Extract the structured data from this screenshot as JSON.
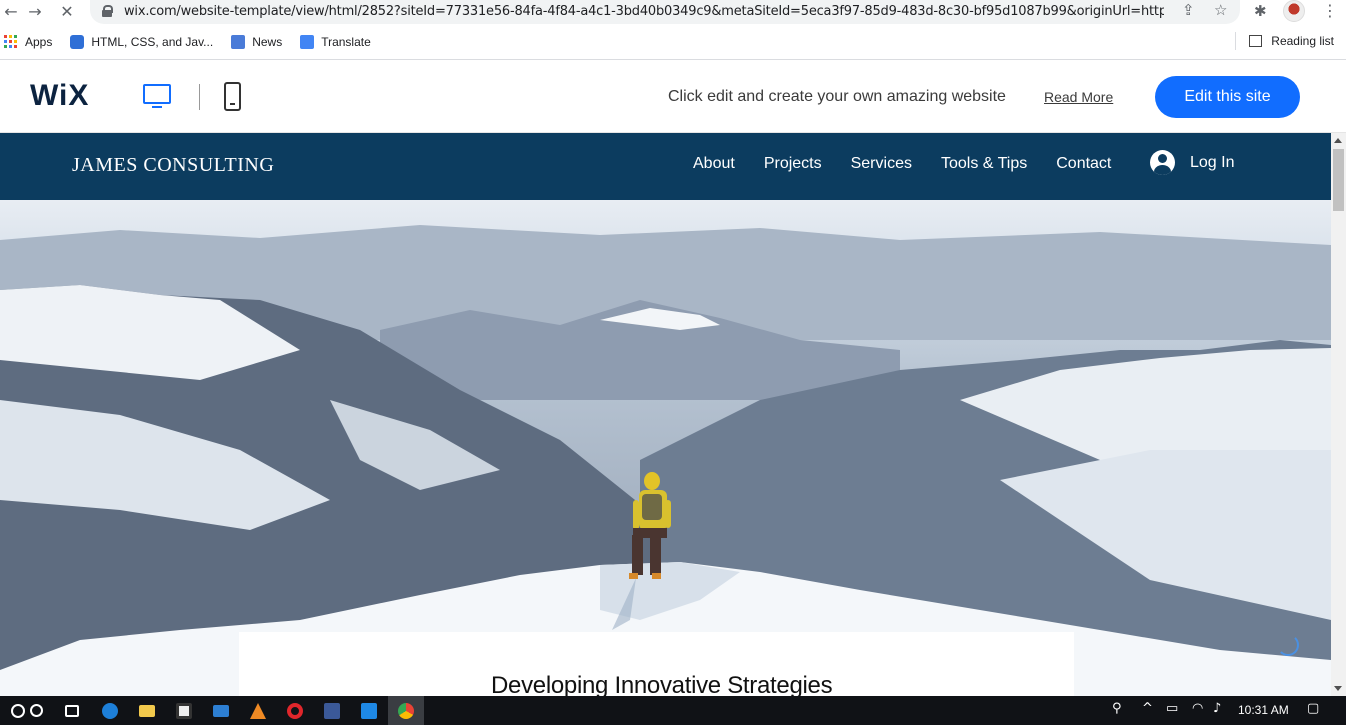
{
  "browser": {
    "url": "wix.com/website-template/view/html/2852?siteId=77331e56-84fa-4f84-a4c1-3bd40b0349c9&metaSiteId=5eca3f97-85d9-483d-8c30-bf95d1087b99&originUrl=https%...",
    "icons": {
      "back": "back-arrow-icon",
      "forward": "forward-arrow-icon",
      "stop": "stop-loading-icon",
      "share": "share-icon",
      "bookmark": "star-icon",
      "extensions": "puzzle-icon",
      "menu": "kebab-menu-icon"
    }
  },
  "bookmarks": {
    "items": [
      {
        "label": "Apps",
        "icon": "apps-grid-icon"
      },
      {
        "label": "HTML, CSS, and Jav...",
        "icon": "html-css-icon"
      },
      {
        "label": "News",
        "icon": "news-icon"
      },
      {
        "label": "Translate",
        "icon": "translate-icon"
      }
    ],
    "reading_list": "Reading list"
  },
  "wix_bar": {
    "logo": "WiX",
    "promo_text": "Click edit and create your own amazing website",
    "read_more": "Read More",
    "edit_button": "Edit this site",
    "accent": "#116dff"
  },
  "site": {
    "title": "JAMES CONSULTING",
    "nav": [
      "About",
      "Projects",
      "Services",
      "Tools & Tips",
      "Contact"
    ],
    "login": "Log In",
    "header_color": "#0c3c5f"
  },
  "hero": {
    "heading": "Developing Innovative Strategies"
  },
  "taskbar": {
    "time": "10:31 AM",
    "apps": [
      "start-icon",
      "search-icon",
      "task-view-icon",
      "edge-icon",
      "file-explorer-icon",
      "store-icon",
      "mail-icon",
      "vlc-icon",
      "opera-icon",
      "facebook-icon",
      "vscode-icon",
      "chrome-icon"
    ]
  }
}
